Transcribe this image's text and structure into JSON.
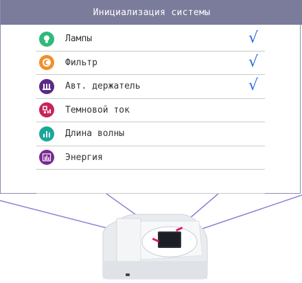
{
  "header": {
    "title": "Инициализация системы"
  },
  "items": [
    {
      "label": "Лампы",
      "checked": true,
      "color": "#2fb97a",
      "icon": "bulb-icon"
    },
    {
      "label": "Фильтр",
      "checked": true,
      "color": "#f0902a",
      "icon": "filter-icon"
    },
    {
      "label": "Авт. держатель",
      "checked": true,
      "color": "#5a2a86",
      "icon": "holder-icon"
    },
    {
      "label": "Темновой ток",
      "checked": false,
      "color": "#c8245a",
      "icon": "dark-current-icon"
    },
    {
      "label": "Длина волны",
      "checked": false,
      "color": "#1aa79a",
      "icon": "wavelength-icon"
    },
    {
      "label": "Энергия",
      "checked": false,
      "color": "#7b2a92",
      "icon": "energy-icon"
    }
  ],
  "check_mark": "√"
}
